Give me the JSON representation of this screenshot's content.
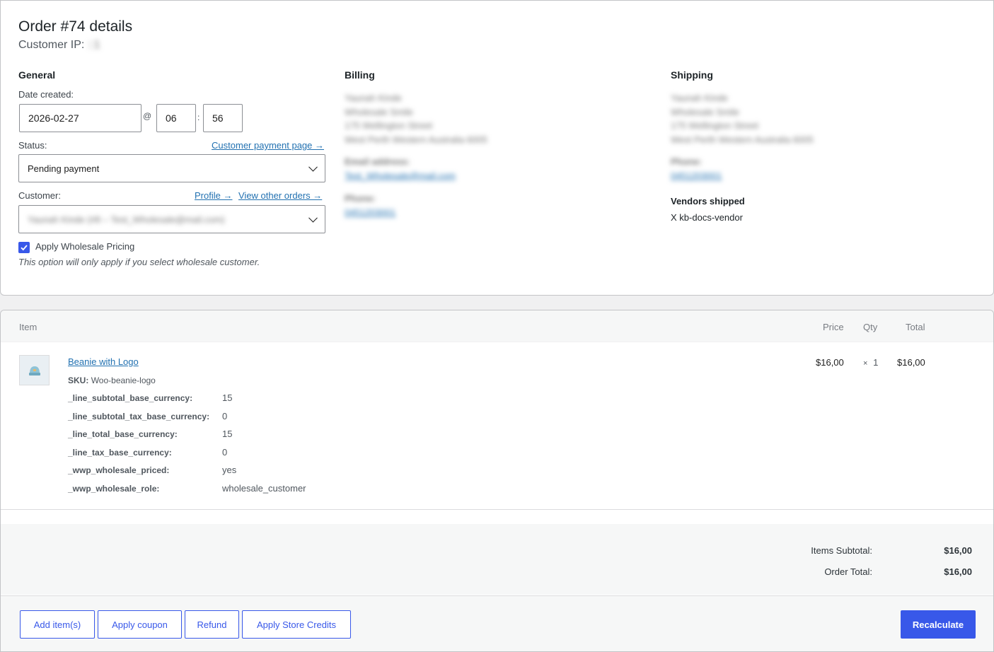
{
  "order": {
    "title": "Order #74 details",
    "customer_ip_label": "Customer IP:",
    "customer_ip_value": "::1"
  },
  "general": {
    "heading": "General",
    "date_label": "Date created:",
    "date_value": "2026-02-27",
    "at_sep": "@",
    "hour": "06",
    "time_sep": ":",
    "minute": "56",
    "status_label": "Status:",
    "customer_payment_link": "Customer payment page →",
    "status_value": "Pending payment",
    "customer_label": "Customer:",
    "profile_link": "Profile →",
    "view_orders_link": "View other orders →",
    "customer_value": "Yaunah Kinde (#8 – Test_Wholesale@mail.com)",
    "wholesale_checkbox_label": "Apply Wholesale Pricing",
    "wholesale_note": "This option will only apply if you select wholesale customer."
  },
  "billing": {
    "heading": "Billing",
    "address_lines": [
      "Yaunah Kinde",
      "Wholesale Smile",
      "175 Wellington Street",
      "West Perth Western Australia 6005"
    ],
    "email_label": "Email address:",
    "email_value": "Test_Wholesale@mail.com",
    "phone_label": "Phone:",
    "phone_value": "0451203001"
  },
  "shipping": {
    "heading": "Shipping",
    "address_lines": [
      "Yaunah Kinde",
      "Wholesale Smile",
      "175 Wellington Street",
      "West Perth Western Australia 6005"
    ],
    "phone_label": "Phone:",
    "phone_value": "0451203001",
    "vendors_heading": "Vendors shipped",
    "vendor_mark": "X",
    "vendor_name": "kb-docs-vendor"
  },
  "items": {
    "headers": {
      "item": "Item",
      "price": "Price",
      "qty": "Qty",
      "total": "Total"
    },
    "product_name": "Beanie with Logo",
    "sku_label": "SKU:",
    "sku_value": "Woo-beanie-logo",
    "meta": [
      {
        "key": "_line_subtotal_base_currency:",
        "value": "15"
      },
      {
        "key": "_line_subtotal_tax_base_currency:",
        "value": "0"
      },
      {
        "key": "_line_total_base_currency:",
        "value": "15"
      },
      {
        "key": "_line_tax_base_currency:",
        "value": "0"
      },
      {
        "key": "_wwp_wholesale_priced:",
        "value": "yes"
      },
      {
        "key": "_wwp_wholesale_role:",
        "value": "wholesale_customer"
      }
    ],
    "price": "$16,00",
    "qty_times": "×",
    "qty": "1",
    "total": "$16,00"
  },
  "totals": {
    "items_subtotal_label": "Items Subtotal:",
    "items_subtotal_value": "$16,00",
    "order_total_label": "Order Total:",
    "order_total_value": "$16,00"
  },
  "actions": {
    "add_items": "Add item(s)",
    "apply_coupon": "Apply coupon",
    "refund": "Refund",
    "apply_store_credits": "Apply Store Credits",
    "recalculate": "Recalculate"
  },
  "colors": {
    "accent": "#3858e9",
    "link": "#2271b1"
  }
}
